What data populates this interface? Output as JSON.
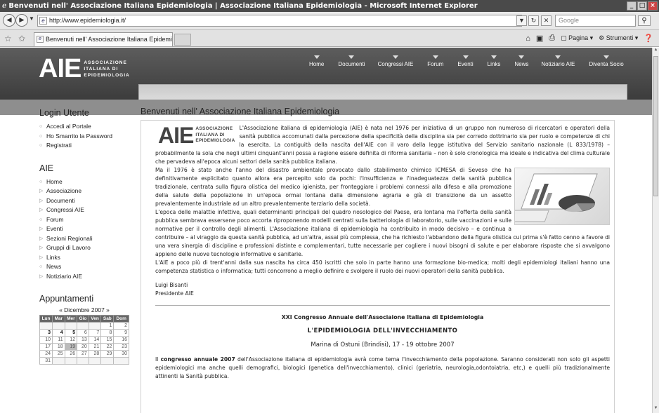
{
  "window": {
    "title": "Benvenuti nell' Associazione Italiana Epidemiologia | Associazione Italiana Epidemiologia - Microsoft Internet Explorer",
    "minimize": "_",
    "maximize": "□",
    "close": "×"
  },
  "address": {
    "url": "http://www.epidemiologia.it/",
    "search_placeholder": "Google"
  },
  "tab": {
    "label": "Benvenuti nell' Associazione Italiana Epidemiologia | A..."
  },
  "commandbar": {
    "page_label": "Pagina",
    "tools_label": "Strumenti"
  },
  "site": {
    "logo_big": "AIE",
    "logo_line1": "ASSOCIAZIONE",
    "logo_line2": "ITALIANA DI",
    "logo_line3": "EPIDEMIOLOGIA",
    "nav": [
      "Home",
      "Documenti",
      "Congressi AIE",
      "Forum",
      "Eventi",
      "Links",
      "News",
      "Notiziario AIE",
      "Diventa Socio"
    ]
  },
  "sidebar": {
    "login_title": "Login Utente",
    "login_items": [
      "Accedi al Portale",
      "Ho Smarrito la Password",
      "Registrati"
    ],
    "aie_title": "AIE",
    "aie_items": [
      "Home",
      "Associazione",
      "Documenti",
      "Congressi AIE",
      "Forum",
      "Eventi",
      "Sezioni Regionali",
      "Gruppi di Lavoro",
      "Links",
      "News",
      "Notiziario AIE"
    ],
    "appointments_title": "Appuntamenti",
    "calendar": {
      "caption": "« Dicembre 2007 »",
      "headers": [
        "Lun",
        "Mar",
        "Mer",
        "Gio",
        "Ven",
        "Sab",
        "Dom"
      ],
      "weeks": [
        [
          "",
          "",
          "",
          "",
          "",
          "1",
          "2"
        ],
        [
          "3",
          "4",
          "5",
          "6",
          "7",
          "8",
          "9"
        ],
        [
          "10",
          "11",
          "12",
          "13",
          "14",
          "15",
          "16"
        ],
        [
          "17",
          "18",
          "19",
          "20",
          "21",
          "22",
          "23"
        ],
        [
          "24",
          "25",
          "26",
          "27",
          "28",
          "29",
          "30"
        ],
        [
          "31",
          "",
          "",
          "",
          "",
          "",
          ""
        ]
      ]
    }
  },
  "main": {
    "heading": "Benvenuti nell' Associazione Italiana Epidemiologia",
    "logo_big": "AIE",
    "logo_line1": "ASSOCIAZIONE",
    "logo_line2": "ITALIANA DI",
    "logo_line3": "EPIDEMIOLOGIA",
    "p1": "L'Associazione italiana di epidemiologia (AIE) è nata nel 1976 per iniziativa di un gruppo non numeroso di ricercatori e operatori della sanità pubblica accomunati dalla percezione della specificità della disciplina sia per corredo dottrinario sia per ruolo e competenze di chi la esercita. La contiguità della nascita dell'AIE con il varo della legge istitutiva del Servizio sanitario nazionale (L 833/1978) – probabilmente la sola che negli ultimi cinquant'anni possa a ragione essere definita di riforma sanitaria – non è solo cronologica ma ideale e indicativa del clima culturale che pervadeva all'epoca alcuni settori della sanità pubblica italiana.",
    "p2": "Ma il 1976 è stato anche l'anno del disastro ambientale provocato dallo stabilimento chimico ICMESA di Seveso che ha definitivamente esplicitato quanto allora era percepito solo da pochi: l'insufficienza e l'inadeguatezza della sanità pubblica tradizionale, centrata sulla figura olistica del medico igienista, per fronteggiare i problemi connessi alla difesa e alla promozione della salute della popolazione in un'epoca ormai lontana dalla dimensione agraria e già di transizione da un assetto prevalentemente industriale ad un altro prevalentemente terziario della società.",
    "p3": "L'epoca delle malattie infettive, quali determinanti principali del quadro nosologico del Paese, era lontana ma l'offerta della sanità pubblica sembrava essersene poco accorta riproponendo modelli centrati sulla batteriologia di laboratorio, sulle vaccinazioni e sulle normative per il controllo degli alimenti. L'Associazione italiana di epidemiologia ha contribuito in modo decisivo – e continua a contribuire – al viraggio da questa sanità pubblica, ad un'altra, assai più complessa, che ha richiesto l'abbandono della figura olistica cui prima s'è fatto cenno a favore di una vera sinergia di discipline e professioni distinte e complementari, tutte necessarie per cogliere i nuovi bisogni di salute e per elaborare risposte che si avvalgono appieno delle nuove tecnologie informative e sanitarie.",
    "p4": "L'AIE a poco più di trent'anni dalla sua nascita ha circa 450 iscritti che solo in parte hanno una formazione bio-medica; molti degli epidemiologi italiani hanno una competenza statistica o informatica; tutti concorrono a meglio definire e svolgere il ruolo dei nuovi operatori della sanità pubblica.",
    "signature_name": "Luigi Bisanti",
    "signature_role": "Presidente AIE",
    "congress_title": "XXI Congresso Annuale dell'Associaione Italiana di Epidemiologia",
    "congress_theme": "L'EPIDEMIOLOGIA DELL'INVECCHIAMENTO",
    "congress_place": "Marina di Ostuni (Brindisi), 17 - 19 ottobre 2007",
    "congress_intro_pre": "Il ",
    "congress_intro_bold": "congresso annuale 2007",
    "congress_intro_post": " dell'Associazione italiana di epidemiologia avrà come tema l'invecchiamento della popolazione. Saranno considerati non solo gli aspetti epidemiologici ma anche quelli demografici, biologici (genetica dell'invecchiamento), clinici (geriatria, neurologia,odontoiatria, etc,) e quelli più tradizionalmente attinenti la Sanità pubblica."
  }
}
